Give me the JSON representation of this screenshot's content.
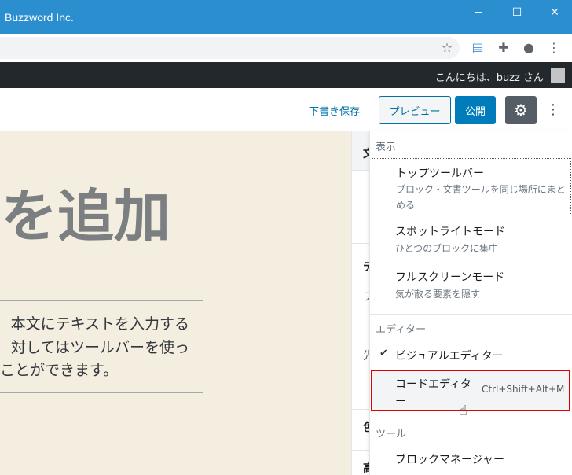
{
  "window": {
    "title": "Buzzword Inc.",
    "minimize": "−",
    "maximize": "☐",
    "close": "✕"
  },
  "browser_toolbar": {
    "icons": [
      "star-icon",
      "reader-extension-icon",
      "puzzle-extension-icon",
      "profile-icon",
      "kebab-menu-icon"
    ]
  },
  "admin_bar": {
    "greeting": "こんにちは、buzz さん"
  },
  "editor_header": {
    "save_draft": "下書き保存",
    "preview": "プレビュー",
    "publish": "公開",
    "settings_icon": "gear-icon",
    "more_icon": "more-vertical-icon"
  },
  "content": {
    "title": "を追加",
    "paragraph": [
      "本文にテキストを入力する",
      "対してはツールバーを使っ",
      "ることができます。"
    ]
  },
  "sidebar_fragments": [
    "文",
    "テ",
    "フ",
    "先",
    "色",
    "高"
  ],
  "menu": {
    "sections": [
      {
        "label": "表示",
        "items": [
          {
            "label": "トップツールバー",
            "description": "ブロック・文書ツールを同じ場所にまとめる"
          },
          {
            "label": "スポットライトモード",
            "description": "ひとつのブロックに集中"
          },
          {
            "label": "フルスクリーンモード",
            "description": "気が散る要素を隠す"
          }
        ]
      },
      {
        "label": "エディター",
        "items": [
          {
            "label": "ビジュアルエディター",
            "checked": true
          },
          {
            "label": "コードエディター",
            "shortcut": "Ctrl+Shift+Alt+M",
            "highlighted": true
          }
        ]
      },
      {
        "label": "ツール",
        "items": [
          {
            "label": "ブロックマネージャー"
          }
        ]
      }
    ]
  },
  "colors": {
    "titlebar": "#2b8ecf",
    "admin_bar": "#23282d",
    "primary": "#007cba",
    "canvas": "#f4eee0",
    "highlight_border": "#e00000"
  }
}
